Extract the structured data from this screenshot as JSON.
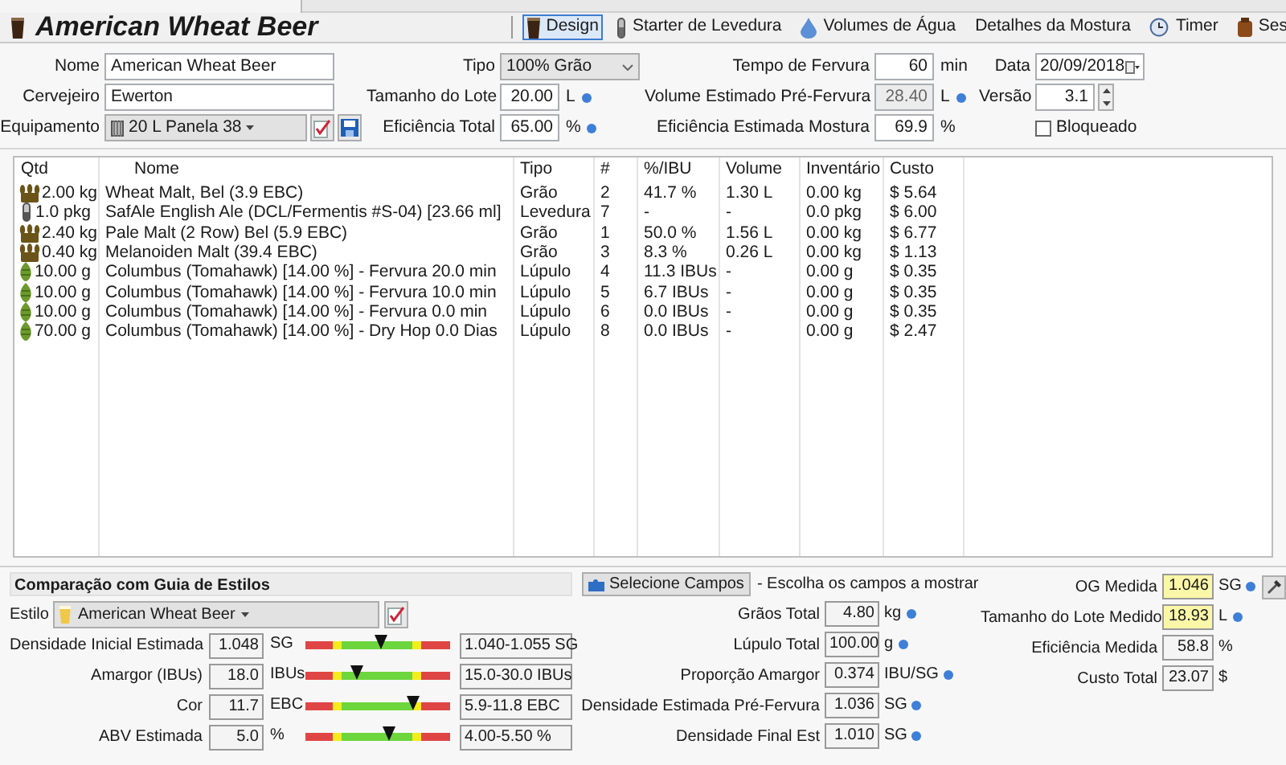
{
  "recipe_title": "American Wheat Beer",
  "toolbar": [
    {
      "label": "Design",
      "selected": true
    },
    {
      "label": "Starter de Levedura",
      "selected": false
    },
    {
      "label": "Volumes de Água",
      "selected": false
    },
    {
      "label": "Detalhes da Mostura",
      "selected": false
    },
    {
      "label": "Timer",
      "selected": false
    },
    {
      "label": "Ses",
      "selected": false
    }
  ],
  "form": {
    "nome": {
      "label": "Nome",
      "value": "American Wheat Beer"
    },
    "cervejeiro": {
      "label": "Cervejeiro",
      "value": "Ewerton"
    },
    "equipamento": {
      "label": "Equipamento",
      "value": "20 L Panela 38"
    },
    "tipo": {
      "label": "Tipo",
      "value": "100% Grão"
    },
    "tamanho_lote": {
      "label": "Tamanho do Lote",
      "value": "20.00",
      "unit": "L",
      "info": true,
      "disabled": false
    },
    "eficiencia_total": {
      "label": "Eficiência Total",
      "value": "65.00",
      "unit": "%",
      "info": true,
      "disabled": false
    },
    "tempo_fervura": {
      "label": "Tempo de Fervura",
      "value": "60",
      "unit": "min",
      "info": false,
      "disabled": false
    },
    "volume_pre_fervura": {
      "label": "Volume Estimado Pré-Fervura",
      "value": "28.40",
      "unit": "L",
      "info": true,
      "disabled": true
    },
    "eficiencia_mostura": {
      "label": "Eficiência Estimada Mostura",
      "value": "69.9",
      "unit": "%",
      "info": false,
      "disabled": false
    },
    "data": {
      "label": "Data",
      "value": "20/09/2018"
    },
    "versao": {
      "label": "Versão",
      "value": "3.1"
    },
    "bloqueado": {
      "label": "Bloqueado",
      "checked": false
    }
  },
  "ingredients": {
    "columns": [
      "Qtd",
      "Nome",
      "Tipo",
      "#",
      "%/IBU",
      "Volume",
      "Inventário",
      "Custo"
    ],
    "rows": [
      {
        "kind": "grain",
        "cells": [
          "2.00 kg",
          "Wheat Malt, Bel (3.9 EBC)",
          "Grão",
          "2",
          "41.7 %",
          "1.30 L",
          "0.00 kg",
          "$ 5.64"
        ]
      },
      {
        "kind": "yeast",
        "cells": [
          "1.0 pkg",
          "SafAle English Ale (DCL/Fermentis #S-04) [23.66 ml]",
          "Levedura",
          "7",
          "-",
          "-",
          "0.0 pkg",
          "$ 6.00"
        ]
      },
      {
        "kind": "grain",
        "cells": [
          "2.40 kg",
          "Pale Malt (2 Row) Bel (5.9 EBC)",
          "Grão",
          "1",
          "50.0 %",
          "1.56 L",
          "0.00 kg",
          "$ 6.77"
        ]
      },
      {
        "kind": "grain",
        "cells": [
          "0.40 kg",
          "Melanoiden Malt (39.4 EBC)",
          "Grão",
          "3",
          "8.3 %",
          "0.26 L",
          "0.00 kg",
          "$ 1.13"
        ]
      },
      {
        "kind": "hop",
        "cells": [
          "10.00 g",
          "Columbus (Tomahawk) [14.00 %] - Fervura 20.0 min",
          "Lúpulo",
          "4",
          "11.3 IBUs",
          "-",
          "0.00 g",
          "$ 0.35"
        ]
      },
      {
        "kind": "hop",
        "cells": [
          "10.00 g",
          "Columbus (Tomahawk) [14.00 %] - Fervura 10.0 min",
          "Lúpulo",
          "5",
          "6.7 IBUs",
          "-",
          "0.00 g",
          "$ 0.35"
        ]
      },
      {
        "kind": "hop",
        "cells": [
          "10.00 g",
          "Columbus (Tomahawk) [14.00 %] - Fervura 0.0 min",
          "Lúpulo",
          "6",
          "0.0 IBUs",
          "-",
          "0.00 g",
          "$ 0.35"
        ]
      },
      {
        "kind": "hop",
        "cells": [
          "70.00 g",
          "Columbus (Tomahawk) [14.00 %] - Dry Hop 0.0 Dias",
          "Lúpulo",
          "8",
          "0.0 IBUs",
          "-",
          "0.00 g",
          "$ 2.47"
        ]
      }
    ]
  },
  "style_guide": {
    "title": "Comparação com Guia de Estilos",
    "style_label": "Estilo",
    "style_value": "American Wheat Beer",
    "metrics": [
      {
        "label": "Densidade Inicial Estimada",
        "value": "1.048",
        "unit": "SG",
        "level": 0.52,
        "range": "1.040-1.055 SG"
      },
      {
        "label": "Amargor (IBUs)",
        "value": "18.0",
        "unit": "IBUs",
        "level": 0.35,
        "range": "15.0-30.0 IBUs"
      },
      {
        "label": "Cor",
        "value": "11.7",
        "unit": "EBC",
        "level": 0.74,
        "range": "5.9-11.8 EBC"
      },
      {
        "label": "ABV Estimada",
        "value": "5.0",
        "unit": "%",
        "level": 0.58,
        "range": "4.00-5.50 %"
      }
    ]
  },
  "fields_button": {
    "label": "Selecione Campos",
    "hint": "- Escolha os campos a mostrar"
  },
  "stats": [
    {
      "label": "Grãos Total",
      "value": "4.80",
      "unit": "kg",
      "info": true
    },
    {
      "label": "Lúpulo Total",
      "value": "100.00",
      "unit": "g",
      "info": true
    },
    {
      "label": "Proporção Amargor",
      "value": "0.374",
      "unit": "IBU/SG",
      "info": true
    },
    {
      "label": "Densidade Estimada Pré-Fervura",
      "value": "1.036",
      "unit": "SG",
      "info": true
    },
    {
      "label": "Densidade Final Est",
      "value": "1.010",
      "unit": "SG",
      "info": true
    }
  ],
  "measured": [
    {
      "label": "OG Medida",
      "value": "1.046",
      "unit": "SG",
      "info": true,
      "highlighted": true
    },
    {
      "label": "Tamanho do Lote Medido",
      "value": "18.93",
      "unit": "L",
      "info": true,
      "highlighted": true
    },
    {
      "label": "Eficiência Medida",
      "value": "58.8",
      "unit": "%",
      "info": false,
      "highlighted": false
    },
    {
      "label": "Custo Total",
      "value": "23.07",
      "unit": "$",
      "info": false,
      "highlighted": false
    }
  ]
}
